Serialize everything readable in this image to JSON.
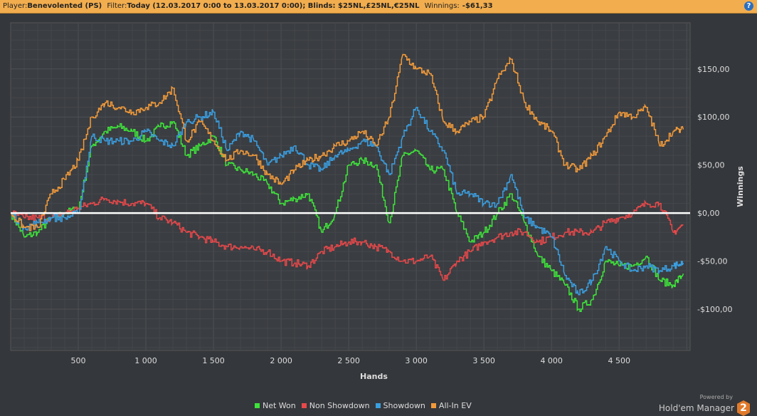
{
  "header": {
    "player_label": "Player:",
    "player": "Benevolented (PS)",
    "filter_label": "Filter:",
    "filter": "Today (12.03.2017 0:00 to 13.03.2017 0:00); Blinds: $25NL,£25NL,€25NL",
    "winnings_label": "Winnings:",
    "winnings": "-$61,33",
    "help": "?"
  },
  "brand": {
    "powered_by": "Powered by",
    "name": "Hold'em Manager",
    "logo": "2"
  },
  "chart_data": {
    "type": "line",
    "xlabel": "Hands",
    "ylabel": "Winnings",
    "xlim": [
      0,
      5025
    ],
    "ylim": [
      -143,
      198
    ],
    "x_ticks": [
      500,
      1000,
      1500,
      2000,
      2500,
      3000,
      3500,
      4000,
      4500
    ],
    "x_tick_labels": [
      "500",
      "1 000",
      "1 500",
      "2 000",
      "2 500",
      "3 000",
      "3 500",
      "4 000",
      "4 500"
    ],
    "y_ticks": [
      -100,
      -50,
      0,
      50,
      100,
      150
    ],
    "y_tick_labels": [
      "-$100,00",
      "-$50,00",
      "$0,00",
      "$50,00",
      "$100,00",
      "$150,00"
    ],
    "grid": true,
    "legend": "bottom-center",
    "x": [
      0,
      100,
      200,
      300,
      400,
      500,
      600,
      700,
      800,
      900,
      1000,
      1100,
      1200,
      1300,
      1400,
      1500,
      1600,
      1700,
      1800,
      1900,
      2000,
      2100,
      2200,
      2300,
      2400,
      2500,
      2600,
      2700,
      2800,
      2900,
      3000,
      3100,
      3200,
      3300,
      3400,
      3500,
      3600,
      3700,
      3800,
      3900,
      4000,
      4100,
      4200,
      4300,
      4400,
      4500,
      4600,
      4700,
      4800,
      4900,
      4975
    ],
    "series": [
      {
        "name": "Net Won",
        "color": "#3ee43a",
        "values": [
          0,
          -25,
          -20,
          -5,
          0,
          5,
          70,
          85,
          90,
          85,
          75,
          90,
          95,
          60,
          70,
          80,
          50,
          45,
          40,
          30,
          10,
          15,
          20,
          -20,
          0,
          50,
          55,
          50,
          -10,
          60,
          65,
          45,
          45,
          0,
          -30,
          -20,
          0,
          20,
          -10,
          -45,
          -60,
          -75,
          -100,
          -90,
          -50,
          -55,
          -55,
          -45,
          -70,
          -75,
          -63
        ]
      },
      {
        "name": "Non Showdown",
        "color": "#e8484a",
        "values": [
          0,
          -5,
          -5,
          -5,
          0,
          5,
          10,
          15,
          12,
          10,
          10,
          -5,
          -10,
          -20,
          -25,
          -30,
          -35,
          -35,
          -38,
          -40,
          -50,
          -52,
          -55,
          -40,
          -35,
          -30,
          -30,
          -35,
          -40,
          -50,
          -50,
          -45,
          -70,
          -50,
          -40,
          -30,
          -25,
          -20,
          -20,
          -30,
          -25,
          -20,
          -20,
          -20,
          -10,
          -5,
          0,
          10,
          10,
          -20,
          -12
        ]
      },
      {
        "name": "Showdown",
        "color": "#3a9ee0",
        "values": [
          0,
          -15,
          -10,
          -5,
          -5,
          0,
          80,
          75,
          75,
          75,
          85,
          75,
          70,
          95,
          100,
          105,
          65,
          85,
          75,
          50,
          60,
          70,
          50,
          45,
          60,
          65,
          75,
          70,
          40,
          80,
          110,
          85,
          65,
          20,
          20,
          10,
          10,
          40,
          -5,
          -15,
          -25,
          -65,
          -85,
          -70,
          -35,
          -50,
          -60,
          -55,
          -60,
          -55,
          -52
        ]
      },
      {
        "name": "All-In EV",
        "color": "#f29a3a",
        "values": [
          0,
          -15,
          -15,
          20,
          35,
          55,
          100,
          115,
          110,
          105,
          110,
          115,
          130,
          75,
          95,
          75,
          55,
          65,
          60,
          40,
          30,
          45,
          55,
          60,
          70,
          75,
          85,
          70,
          100,
          165,
          150,
          145,
          95,
          85,
          95,
          100,
          140,
          160,
          115,
          95,
          85,
          50,
          45,
          60,
          80,
          105,
          100,
          110,
          70,
          85,
          87
        ]
      }
    ]
  }
}
